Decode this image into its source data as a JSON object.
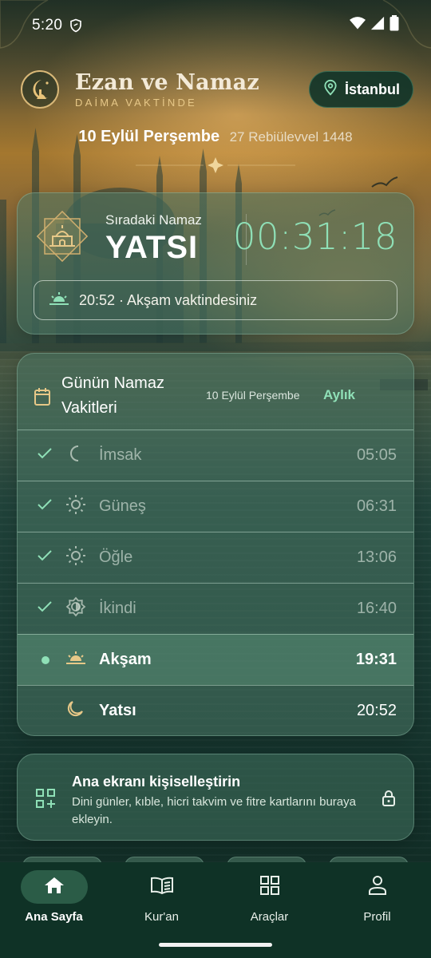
{
  "status_bar": {
    "time": "5:20"
  },
  "header": {
    "app_name": "Ezan ve Namaz",
    "tagline": "DAİMA VAKTİNDE",
    "city": "İstanbul"
  },
  "date": {
    "gregorian": "10 Eylül Perşembe",
    "hijri": "27 Rebiülevvel 1448"
  },
  "next_prayer": {
    "label": "Sıradaki Namaz",
    "name": "YATSI",
    "countdown": "00:31:18",
    "status": "20:52 · Akşam vaktindesiniz"
  },
  "daily_times": {
    "title": "Günün Namaz Vakitleri",
    "date": "10 Eylül Perşembe",
    "monthly_label": "Aylık",
    "prayers": [
      {
        "name": "İmsak",
        "time": "05:05",
        "state": "past",
        "icon": "crescent-moon-icon"
      },
      {
        "name": "Güneş",
        "time": "06:31",
        "state": "past",
        "icon": "sun-icon"
      },
      {
        "name": "Öğle",
        "time": "13:06",
        "state": "past",
        "icon": "sun-icon"
      },
      {
        "name": "İkindi",
        "time": "16:40",
        "state": "past",
        "icon": "half-sun-icon"
      },
      {
        "name": "Akşam",
        "time": "19:31",
        "state": "current",
        "icon": "sunset-icon"
      },
      {
        "name": "Yatsı",
        "time": "20:52",
        "state": "upcoming",
        "icon": "moon-icon"
      }
    ]
  },
  "customize": {
    "title": "Ana ekranı kişiselleştirin",
    "description": "Dini günler, kıble, hicri takvim ve fitre kartlarını buraya ekleyin."
  },
  "nav": {
    "items": [
      {
        "label": "Ana Sayfa",
        "icon": "home-icon",
        "active": true
      },
      {
        "label": "Kur'an",
        "icon": "book-icon",
        "active": false
      },
      {
        "label": "Araçlar",
        "icon": "grid-icon",
        "active": false
      },
      {
        "label": "Profil",
        "icon": "person-icon",
        "active": false
      }
    ]
  },
  "colors": {
    "accent": "#8fe0b7",
    "gold": "#e7c888",
    "nav_bg": "#0f3226"
  }
}
